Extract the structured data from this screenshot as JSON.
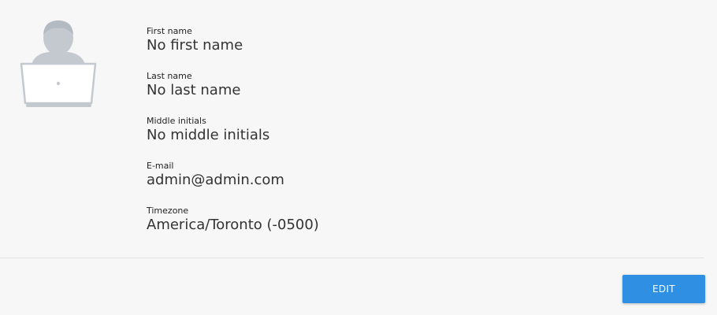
{
  "profile": {
    "avatar_icon": "user-laptop-icon",
    "fields": [
      {
        "label": "First name",
        "value": "No first name"
      },
      {
        "label": "Last name",
        "value": "No last name"
      },
      {
        "label": "Middle initials",
        "value": "No middle initials"
      },
      {
        "label": "E-mail",
        "value": "admin@admin.com"
      },
      {
        "label": "Timezone",
        "value": "America/Toronto (-0500)"
      }
    ]
  },
  "actions": {
    "edit_label": "EDIT"
  },
  "colors": {
    "background": "#f7f7f7",
    "accent": "#2f8fe3",
    "avatar": "#c3c9cf"
  }
}
